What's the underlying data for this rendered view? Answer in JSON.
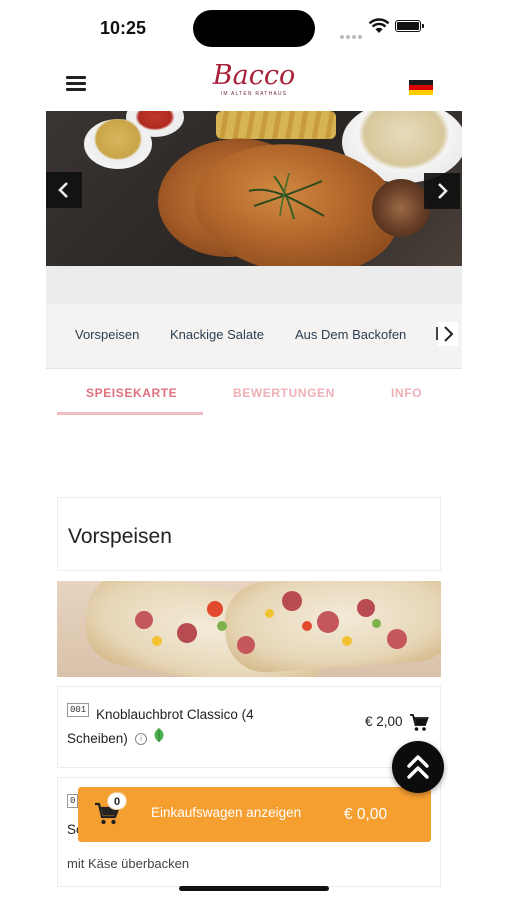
{
  "status_bar": {
    "time": "10:25"
  },
  "header": {
    "logo_text": "Bacco",
    "logo_subtitle": "IM ALTEN RATHAUS",
    "language_flag": "de-flag-icon"
  },
  "hero": {
    "prev_icon": "chevron-left-icon",
    "next_icon": "chevron-right-icon"
  },
  "categories": {
    "items": [
      "Vorspeisen",
      "Knackige Salate",
      "Aus Dem Backofen"
    ],
    "partial_item": "F",
    "next_icon": "chevron-right-icon"
  },
  "tabs": [
    {
      "label": "SPEISEKARTE",
      "active": true
    },
    {
      "label": "BEWERTUNGEN",
      "active": false
    },
    {
      "label": "INFO",
      "active": false
    }
  ],
  "section": {
    "title": "Vorspeisen"
  },
  "products": [
    {
      "number": "001",
      "name_line1": "Knoblauchbrot Classico (4",
      "name_line2": "Scheiben)",
      "price": "€ 2,00",
      "icons": [
        "info-icon",
        "vegetarian-leaf-icon",
        "cart-icon"
      ]
    },
    {
      "number": "0",
      "name_partial": "So",
      "description": "mit Käse überbacken"
    }
  ],
  "cart_bar": {
    "badge_count": "0",
    "label": "Einkaufswagen anzeigen",
    "total": "€ 0,00"
  },
  "colors": {
    "brand": "#a8213a",
    "tab_active": "#e0707e",
    "tab_inactive": "#eeb0b8",
    "cart_bar": "#f69f31",
    "category_text": "#2c3e50"
  }
}
